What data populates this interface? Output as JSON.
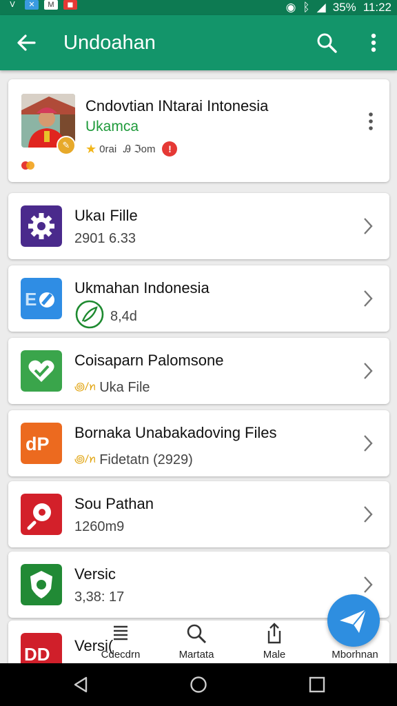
{
  "status_bar": {
    "time": "11:22",
    "battery": "35%",
    "left_icons": [
      "v-icon",
      "x-icon",
      "m-icon",
      "app-icon"
    ]
  },
  "app_bar": {
    "title": "Undoahan",
    "back_icon": "arrow-left-icon",
    "search_icon": "search-icon",
    "more_icon": "more-vert-icon"
  },
  "profile": {
    "name": "Cndovtian INtarai Intonesia",
    "subtitle": "Ukamcа",
    "meta_1": "0rai",
    "meta_2": "Ꭿ ℑom",
    "badge": "!"
  },
  "items": [
    {
      "label": "Ukaı Fille",
      "sub": "2901 6.33",
      "icon_color": "#4a2a8c",
      "icon": "gear-icon"
    },
    {
      "label": "Ukmahan Indonesia",
      "sub": "8,4d",
      "icon_color": "#2f8de4",
      "icon": "eo-icon"
    },
    {
      "label": "Coisaparn Palomsone",
      "sub": "Uka File",
      "icon_color": "#3aa54b",
      "icon": "heart-check-icon"
    },
    {
      "label": "Bornaka Unabakadoving Files",
      "sub": "Fidetatn (2929)",
      "icon_color": "#ec6a1f",
      "icon": "dp-icon"
    },
    {
      "label": "Sou Pathan",
      "sub": "1260m9",
      "icon_color": "#d3202a",
      "icon": "pin-icon"
    },
    {
      "label": "Versic",
      "sub": "3,38: 17",
      "icon_color": "#218a35",
      "icon": "shield-icon"
    },
    {
      "label": "Versi(",
      "sub": "",
      "icon_color": "#d01f2a",
      "icon": "dd-icon"
    }
  ],
  "bottom_nav": [
    {
      "label": "Cdecdrn",
      "icon": "list-icon"
    },
    {
      "label": "Martata",
      "icon": "search-icon"
    },
    {
      "label": "Male",
      "icon": "share-icon"
    },
    {
      "label": "Mborhnan",
      "icon": "send-icon"
    }
  ],
  "colors": {
    "app_bar": "#13956a",
    "status_bar": "#0d7a52",
    "fab": "#2e8ee0",
    "accent_green": "#1e9a3a"
  }
}
